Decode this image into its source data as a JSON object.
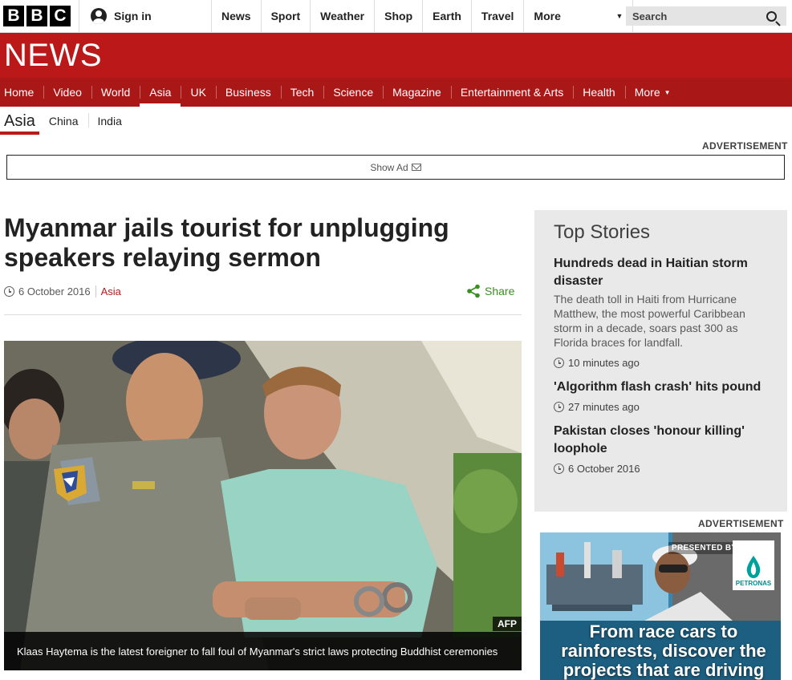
{
  "masthead": {
    "logo_letters": [
      "B",
      "B",
      "C"
    ],
    "sign_in": "Sign in",
    "nav": [
      "News",
      "Sport",
      "Weather",
      "Shop",
      "Earth",
      "Travel"
    ],
    "more": "More",
    "search_label": "Search"
  },
  "banner": {
    "wordmark": "NEWS"
  },
  "section_nav": {
    "items": [
      "Home",
      "Video",
      "World",
      "Asia",
      "UK",
      "Business",
      "Tech",
      "Science",
      "Magazine",
      "Entertainment & Arts",
      "Health"
    ],
    "active": "Asia",
    "more": "More"
  },
  "subnav": {
    "current": "Asia",
    "items": [
      "China",
      "India"
    ]
  },
  "advertisement_label": "ADVERTISEMENT",
  "show_ad": "Show Ad",
  "article": {
    "headline": "Myanmar jails tourist for unplugging speakers relaying sermon",
    "date": "6 October 2016",
    "section": "Asia",
    "share": "Share",
    "image_credit": "AFP",
    "image_caption": "Klaas Haytema is the latest foreigner to fall foul of Myanmar's strict laws protecting Buddhist ceremonies"
  },
  "top_stories": {
    "heading": "Top Stories",
    "stories": [
      {
        "title": "Hundreds dead in Haitian storm disaster",
        "summary": "The death toll in Haiti from Hurricane Matthew, the most powerful Caribbean storm in a decade, soars past 300 as Florida braces for landfall.",
        "time": "10 minutes ago"
      },
      {
        "title": "'Algorithm flash crash' hits pound",
        "summary": "",
        "time": "27 minutes ago"
      },
      {
        "title": "Pakistan closes 'honour killing' loophole",
        "summary": "",
        "time": "6 October 2016"
      }
    ]
  },
  "sidebar_ad": {
    "label": "ADVERTISEMENT",
    "presented_by": "PRESENTED BY",
    "sponsor": "PETRONAS",
    "text": "From race cars to rainforests, discover the projects that are driving"
  },
  "colors": {
    "brand_red": "#bb1919",
    "nav_red": "#a91717",
    "share_green": "#3a8f20",
    "sidebar_bg": "#e9e9e9"
  }
}
